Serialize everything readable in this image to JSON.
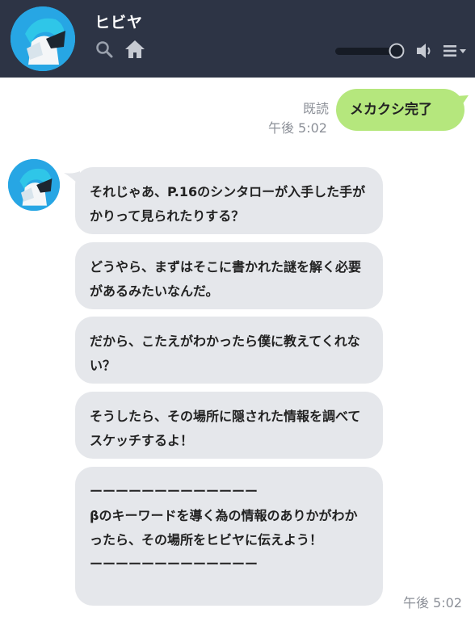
{
  "header": {
    "chat_name": "ヒビヤ",
    "icons": [
      "avatar",
      "search-icon",
      "home-icon",
      "volume-slider",
      "speaker-icon",
      "menu-icon"
    ]
  },
  "sent": {
    "read_label": "既読",
    "time": "午後 5:02",
    "message": "メカクシ完了"
  },
  "received": {
    "time": "午後 5:02",
    "messages": [
      "それじゃあ、P.16のシンタローが入手した手がかりって見られたりする？",
      "どうやら、まずはそこに書かれた謎を解く必要があるみたいなんだ。",
      "だから、こたえがわかったら僕に教えてくれない？",
      "そうしたら、その場所に隠された情報を調べてスケッチするよ！",
      "ーーーーーーーーーーーーー\nβのキーワードを導く為の情報のありかがわかったら、その場所をヒビヤに伝えよう！\nーーーーーーーーーーーーー"
    ]
  },
  "colors": {
    "header_bg": "#2d3445",
    "sent_bubble": "#b5e77d",
    "recv_bubble": "#e5e7eb",
    "avatar_bg": "#27a6e4"
  }
}
